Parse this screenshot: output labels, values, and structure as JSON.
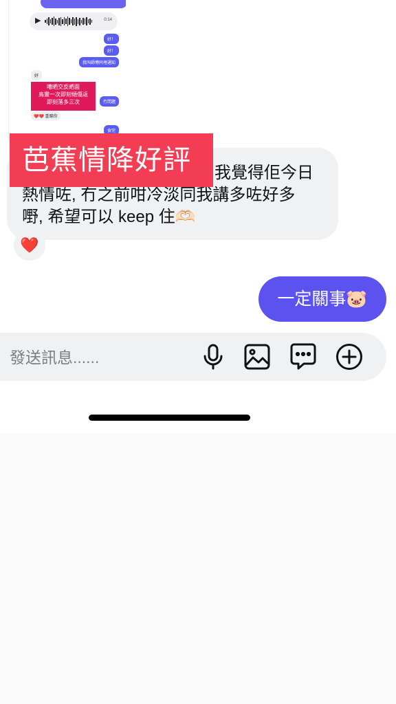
{
  "embedded_screenshot": {
    "voice_duration": "0:14",
    "out_messages": [
      "好！",
      "好！",
      "我叫師傅同埋通知"
    ],
    "in_small": "好",
    "red_card_lines": [
      "嘈晒交反晒面",
      "鳥靈一次即刻傾傷返",
      "即刻落多三次"
    ],
    "out_reply": "冇問題",
    "reaction_text": "❤️❤️ 重睇你",
    "out_last": "食完"
  },
  "banner": {
    "text": "芭蕉情降好評"
  },
  "incoming_message": {
    "lines": [
      "我覺得佢今日",
      "熱情咗, 冇之前咁冷淡同我講多咗好多",
      "嘢, 希望可以 keep 住🫶🏻"
    ]
  },
  "reaction": {
    "emoji": "❤️"
  },
  "outgoing_message": {
    "text": "一定關事🐷"
  },
  "composer": {
    "placeholder": "發送訊息......",
    "icons": [
      "microphone-icon",
      "image-icon",
      "chat-bubble-icon",
      "plus-circle-icon"
    ]
  }
}
